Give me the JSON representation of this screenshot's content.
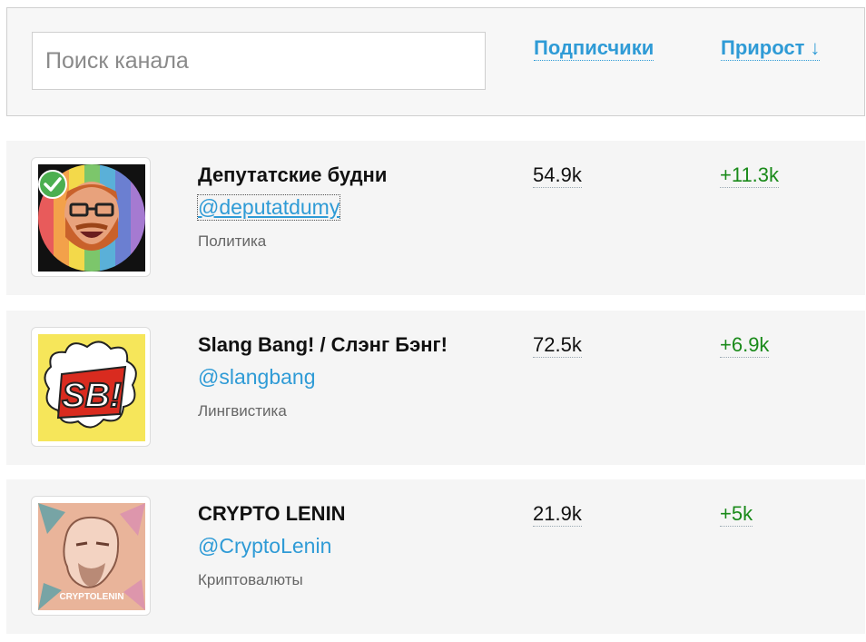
{
  "search": {
    "placeholder": "Поиск канала",
    "value": ""
  },
  "sort": {
    "subscribers_label": "Подписчики",
    "growth_label": "Прирост",
    "growth_arrow": "↓"
  },
  "channels": [
    {
      "title": "Депутатские будни",
      "handle": "@deputatdumy",
      "category": "Политика",
      "subscribers": "54.9k",
      "growth": "+11.3k",
      "verified": true,
      "avatar_icon": "deputat-avatar"
    },
    {
      "title": "Slang Bang! / Слэнг Бэнг!",
      "handle": "@slangbang",
      "category": "Лингвистика",
      "subscribers": "72.5k",
      "growth": "+6.9k",
      "verified": false,
      "avatar_icon": "sb-logo-avatar",
      "avatar_text": "SB!"
    },
    {
      "title": "CRYPTO LENIN",
      "handle": "@CryptoLenin",
      "category": "Криптовалюты",
      "subscribers": "21.9k",
      "growth": "+5k",
      "verified": false,
      "avatar_icon": "crypto-lenin-avatar",
      "avatar_text": "CRYPTOLENIN"
    }
  ],
  "colors": {
    "accent": "#2f9bd6",
    "growth": "#1a8a1a",
    "verified": "#4caf50"
  }
}
